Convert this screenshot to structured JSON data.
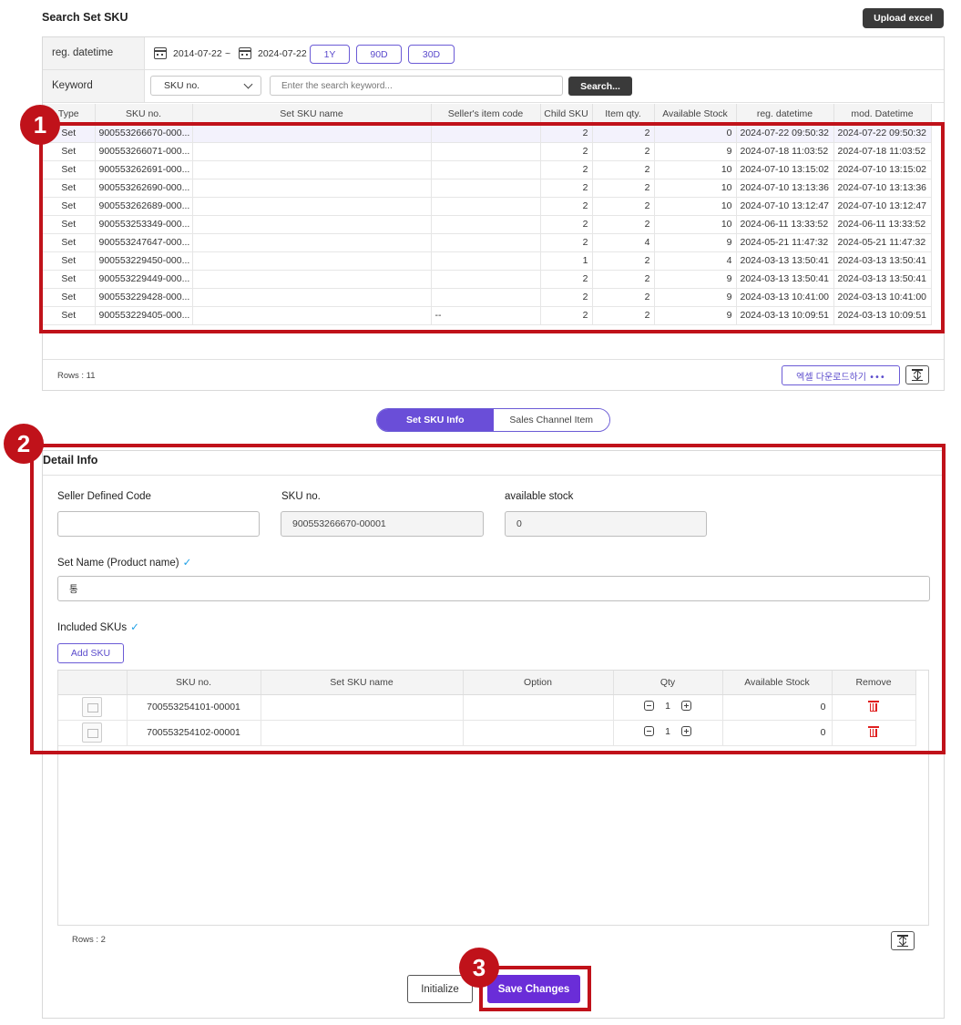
{
  "header": {
    "title": "Search Set SKU",
    "upload_label": "Upload excel"
  },
  "filters": {
    "regdate_label": "reg. datetime",
    "date_from": "2014-07-22",
    "date_sep": "~",
    "date_to": "2024-07-22",
    "periods": [
      "1Y",
      "90D",
      "30D"
    ],
    "keyword_label": "Keyword",
    "keyword_type": "SKU no.",
    "keyword_placeholder": "Enter the search keyword...",
    "search_label": "Search..."
  },
  "sku_table": {
    "columns": [
      "Type",
      "SKU no.",
      "Set SKU name",
      "Seller's item code",
      "Child SKU",
      "Item qty.",
      "Available Stock",
      "reg. datetime",
      "mod. Datetime"
    ],
    "rows": [
      [
        "Set",
        "900553266670-000...",
        "",
        "",
        "2",
        "2",
        "0",
        "2024-07-22 09:50:32",
        "2024-07-22 09:50:32"
      ],
      [
        "Set",
        "900553266071-000...",
        "",
        "",
        "2",
        "2",
        "9",
        "2024-07-18 11:03:52",
        "2024-07-18 11:03:52"
      ],
      [
        "Set",
        "900553262691-000...",
        "",
        "",
        "2",
        "2",
        "10",
        "2024-07-10 13:15:02",
        "2024-07-10 13:15:02"
      ],
      [
        "Set",
        "900553262690-000...",
        "",
        "",
        "2",
        "2",
        "10",
        "2024-07-10 13:13:36",
        "2024-07-10 13:13:36"
      ],
      [
        "Set",
        "900553262689-000...",
        "",
        "",
        "2",
        "2",
        "10",
        "2024-07-10 13:12:47",
        "2024-07-10 13:12:47"
      ],
      [
        "Set",
        "900553253349-000...",
        "",
        "",
        "2",
        "2",
        "10",
        "2024-06-11 13:33:52",
        "2024-06-11 13:33:52"
      ],
      [
        "Set",
        "900553247647-000...",
        "",
        "",
        "2",
        "4",
        "9",
        "2024-05-21 11:47:32",
        "2024-05-21 11:47:32"
      ],
      [
        "Set",
        "900553229450-000...",
        "",
        "",
        "1",
        "2",
        "4",
        "2024-03-13 13:50:41",
        "2024-03-13 13:50:41"
      ],
      [
        "Set",
        "900553229449-000...",
        "",
        "",
        "2",
        "2",
        "9",
        "2024-03-13 13:50:41",
        "2024-03-13 13:50:41"
      ],
      [
        "Set",
        "900553229428-000...",
        "",
        "",
        "2",
        "2",
        "9",
        "2024-03-13 10:41:00",
        "2024-03-13 10:41:00"
      ],
      [
        "Set",
        "900553229405-000...",
        "",
        "--",
        "2",
        "2",
        "9",
        "2024-03-13 10:09:51",
        "2024-03-13 10:09:51"
      ]
    ],
    "rows_label": "Rows : 11",
    "excel_label": "엑셀 다운로드하기 •••"
  },
  "tabs": [
    "Set SKU Info",
    "Sales Channel Item"
  ],
  "detail": {
    "title": "Detail Info",
    "seller_code_label": "Seller Defined Code",
    "seller_code_value": "",
    "sku_no_label": "SKU no.",
    "sku_no_value": "900553266670-00001",
    "stock_label": "available stock",
    "stock_value": "0",
    "set_name_label": "Set Name (Product name)",
    "set_name_value": "통",
    "included_label": "Included SKUs",
    "add_sku_label": "Add SKU",
    "inc_columns": [
      "",
      "SKU no.",
      "Set SKU name",
      "Option",
      "Qty",
      "Available Stock",
      "Remove"
    ],
    "inc_rows": [
      {
        "sku": "700553254101-00001",
        "name": "",
        "option": "",
        "qty": "1",
        "stock": "0"
      },
      {
        "sku": "700553254102-00001",
        "name": "",
        "option": "",
        "qty": "1",
        "stock": "0"
      }
    ],
    "rows_label": "Rows : 2",
    "initialize_label": "Initialize",
    "save_label": "Save Changes"
  },
  "annotations": [
    "1",
    "2",
    "3"
  ],
  "colors": {
    "accent": "#6a4ed8",
    "highlight": "#c0121a",
    "dark_button": "#3a3a3a"
  }
}
